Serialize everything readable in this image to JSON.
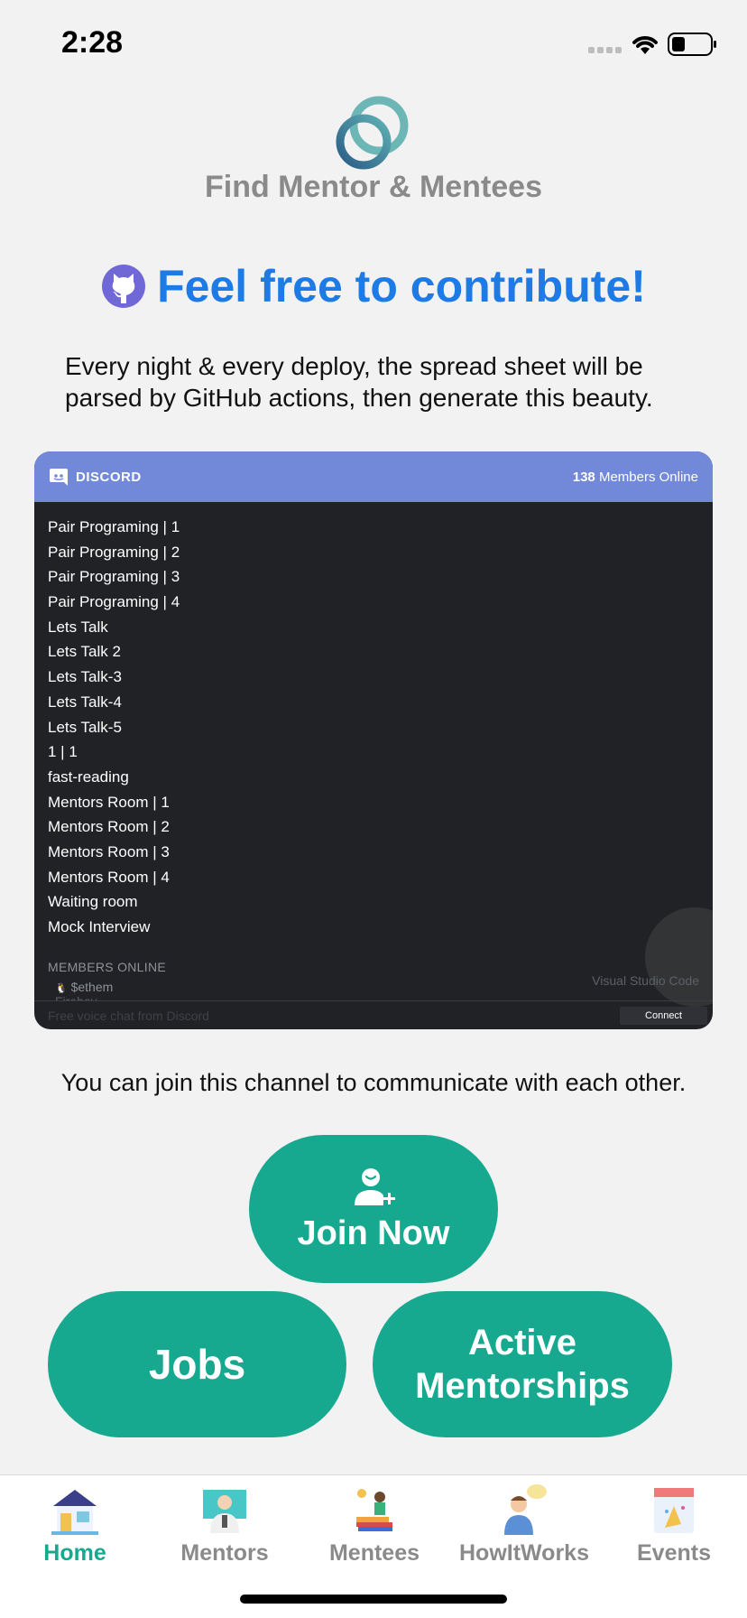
{
  "status": {
    "time": "2:28"
  },
  "header": {
    "app_title": "Find Mentor & Mentees"
  },
  "contribute": {
    "title": "Feel free to contribute!",
    "description": "Every night & every deploy, the spread sheet will be parsed by GitHub actions, then generate this beauty."
  },
  "discord": {
    "brand": "DISCORD",
    "online_count": "138",
    "online_label": "Members Online",
    "channels": [
      "Pair Programing | 1",
      "Pair Programing | 2",
      "Pair Programing | 3",
      "Pair Programing | 4",
      "Lets Talk",
      "Lets Talk 2",
      "Lets Talk-3",
      "Lets Talk-4",
      "Lets Talk-5",
      "1 | 1",
      "fast-reading",
      "Mentors Room | 1",
      "Mentors Room | 2",
      "Mentors Room | 3",
      "Mentors Room | 4",
      "Waiting room",
      "Mock Interview"
    ],
    "members_title": "MEMBERS ONLINE",
    "member_1": "$ethem",
    "member_2": "Fireboy",
    "activity": "Visual Studio Code",
    "footer_text": "Free voice chat from Discord",
    "connect_label": "Connect"
  },
  "join_info": "You can join this channel to communicate with each other.",
  "buttons": {
    "join": "Join Now",
    "jobs": "Jobs",
    "active": "Active Mentorships"
  },
  "tabs": [
    {
      "label": "Home",
      "icon": "home-icon",
      "active": true
    },
    {
      "label": "Mentors",
      "icon": "mentor-icon",
      "active": false
    },
    {
      "label": "Mentees",
      "icon": "mentee-icon",
      "active": false
    },
    {
      "label": "HowItWorks",
      "icon": "how-it-works-icon",
      "active": false
    },
    {
      "label": "Events",
      "icon": "events-icon",
      "active": false
    }
  ],
  "colors": {
    "accent": "#17a98f",
    "link_blue": "#1e7be6",
    "discord_blurple": "#7289da",
    "discord_dark": "#202225"
  }
}
